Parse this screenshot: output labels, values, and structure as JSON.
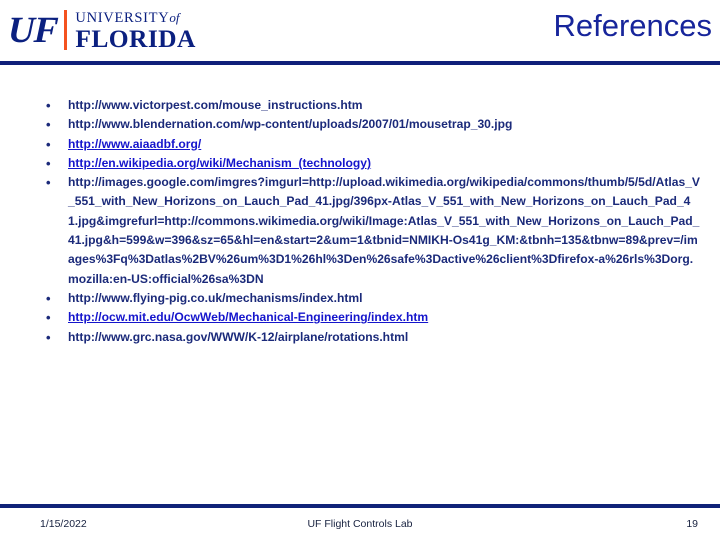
{
  "header": {
    "logo": {
      "mark": "UF",
      "line1_prefix": "UNIVERSITY",
      "line1_suffix": "of",
      "line2": "FLORIDA",
      "divider_color": "#f4521f",
      "text_color": "#0b2080"
    },
    "title": "References",
    "title_color": "#17259b",
    "rule_color": "#0f1f7a"
  },
  "references": [
    {
      "text": "http://www.victorpest.com/mouse_instructions.htm",
      "is_link": false
    },
    {
      "text": "http://www.blendernation.com/wp-content/uploads/2007/01/mousetrap_30.jpg",
      "is_link": false
    },
    {
      "text": "http://www.aiaadbf.org/",
      "is_link": true
    },
    {
      "text": "http://en.wikipedia.org/wiki/Mechanism_(technology)",
      "is_link": true
    },
    {
      "text": "http://images.google.com/imgres?imgurl=http://upload.wikimedia.org/wikipedia/commons/thumb/5/5d/Atlas_V_551_with_New_Horizons_on_Lauch_Pad_41.jpg/396px-Atlas_V_551_with_New_Horizons_on_Lauch_Pad_41.jpg&imgrefurl=http://commons.wikimedia.org/wiki/Image:Atlas_V_551_with_New_Horizons_on_Lauch_Pad_41.jpg&h=599&w=396&sz=65&hl=en&start=2&um=1&tbnid=NMIKH-Os41g_KM:&tbnh=135&tbnw=89&prev=/images%3Fq%3Datlas%2BV%26um%3D1%26hl%3Den%26safe%3Dactive%26client%3Dfirefox-a%26rls%3Dorg.mozilla:en-US:official%26sa%3DN",
      "is_link": false
    },
    {
      "text": "http://www.flying-pig.co.uk/mechanisms/index.html",
      "is_link": false
    },
    {
      "text": "http://ocw.mit.edu/OcwWeb/Mechanical-Engineering/index.htm",
      "is_link": true
    },
    {
      "text": "http://www.grc.nasa.gov/WWW/K-12/airplane/rotations.html",
      "is_link": false
    }
  ],
  "bullet_glyph": "•",
  "footer": {
    "date": "1/15/2022",
    "center": "UF Flight Controls Lab",
    "page_number": "19",
    "rule_color": "#0f2278"
  }
}
